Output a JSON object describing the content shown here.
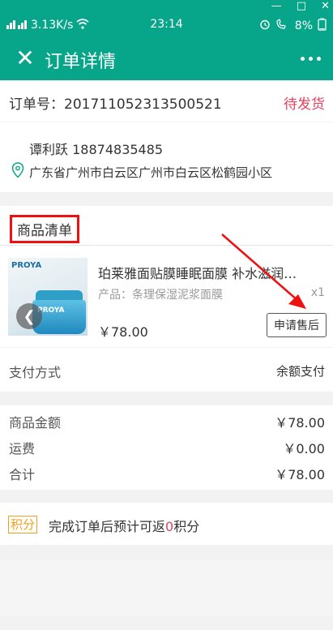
{
  "status_bar": {
    "signal_left": "↑↓",
    "speed": "3.13K/s",
    "time": "23:14",
    "battery": "8%",
    "alarm_icon": "alarm-icon",
    "call_icon": "hd-call-icon"
  },
  "window_controls": {
    "minimize": "—",
    "maximize": "□",
    "close": "✕"
  },
  "nav": {
    "title": "订单详情",
    "close_icon": "✕"
  },
  "order": {
    "label": "订单号：",
    "number": "201711052313500521",
    "status": "待发货"
  },
  "address": {
    "name": "谭利跃",
    "phone": "18874835485",
    "detail": "广东省广州市白云区广州市白云区松鹤园小区"
  },
  "goods": {
    "header": "商品清单",
    "items": [
      {
        "title": "珀莱雅面贴膜睡眠面膜 补水滋润…",
        "spec": "产品：条理保湿泥浆面膜",
        "qty": "x1",
        "price": "￥78.00",
        "action": "申请售后",
        "brand": "PROYA"
      }
    ]
  },
  "payment": {
    "label": "支付方式",
    "value": "余额支付"
  },
  "totals": [
    {
      "label": "商品金额",
      "value": "￥78.00"
    },
    {
      "label": "运费",
      "value": "￥0.00"
    },
    {
      "label": "合计",
      "value": "￥78.00"
    }
  ],
  "points": {
    "badge": "积分",
    "text_before": "完成订单后预计可返",
    "amount": "0",
    "text_after": "积分"
  },
  "colors": {
    "brand_green": "#07a58a",
    "accent_red": "#e5405e",
    "points_orange": "#f0a020"
  }
}
